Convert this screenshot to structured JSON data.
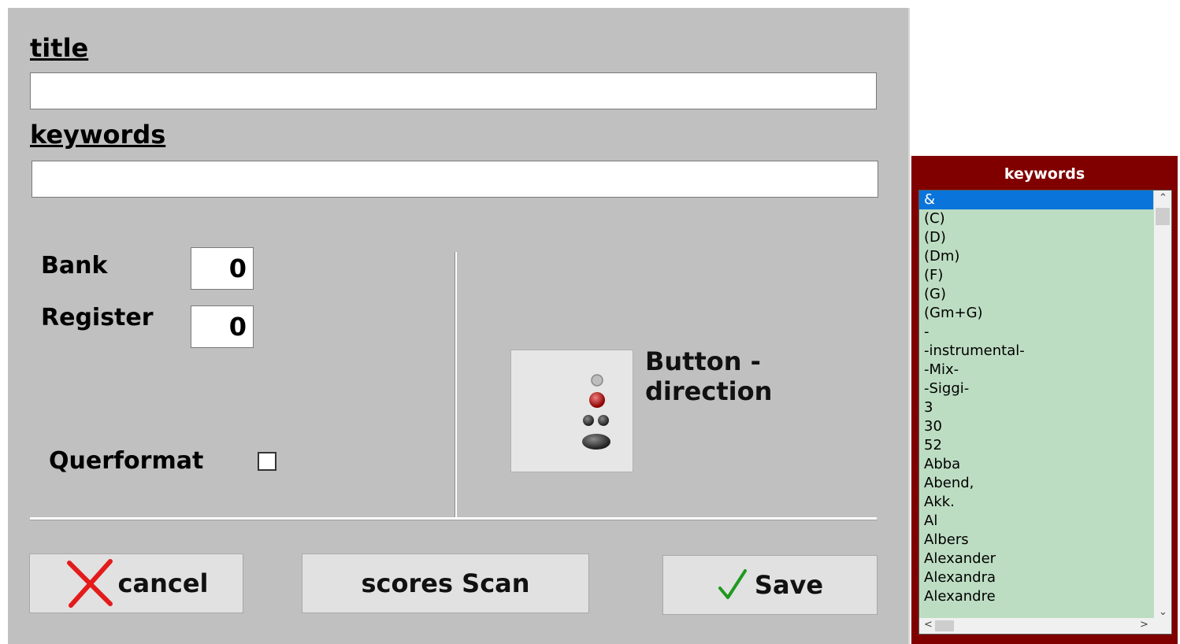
{
  "form": {
    "title_label": "title",
    "title_value": "",
    "keywords_label": "keywords",
    "keywords_value": "",
    "bank_label": "Bank",
    "bank_value": "0",
    "register_label": "Register",
    "register_value": "0",
    "landscape_label": "Querformat",
    "landscape_checked": false,
    "direction_label": "Button -\ndirection"
  },
  "buttons": {
    "cancel": "cancel",
    "scan": "scores Scan",
    "save": "Save"
  },
  "colors": {
    "dialog_bg": "#c0c0c0",
    "panel_bg": "#800000",
    "list_bg": "#bdddc3",
    "selection": "#0a74da",
    "cancel_icon": "#e41b1b",
    "save_icon": "#1e9a1e"
  },
  "keywords_panel": {
    "title": "keywords",
    "items": [
      "&",
      "(C)",
      "(D)",
      "(Dm)",
      "(F)",
      "(G)",
      "(Gm+G)",
      "-",
      "-instrumental-",
      "-Mix-",
      "-Siggi-",
      "3",
      "30",
      "52",
      "Abba",
      "Abend,",
      "Akk.",
      "Al",
      "Albers",
      "Alexander",
      "Alexandra",
      "Alexandre"
    ],
    "selected_index": 0
  }
}
